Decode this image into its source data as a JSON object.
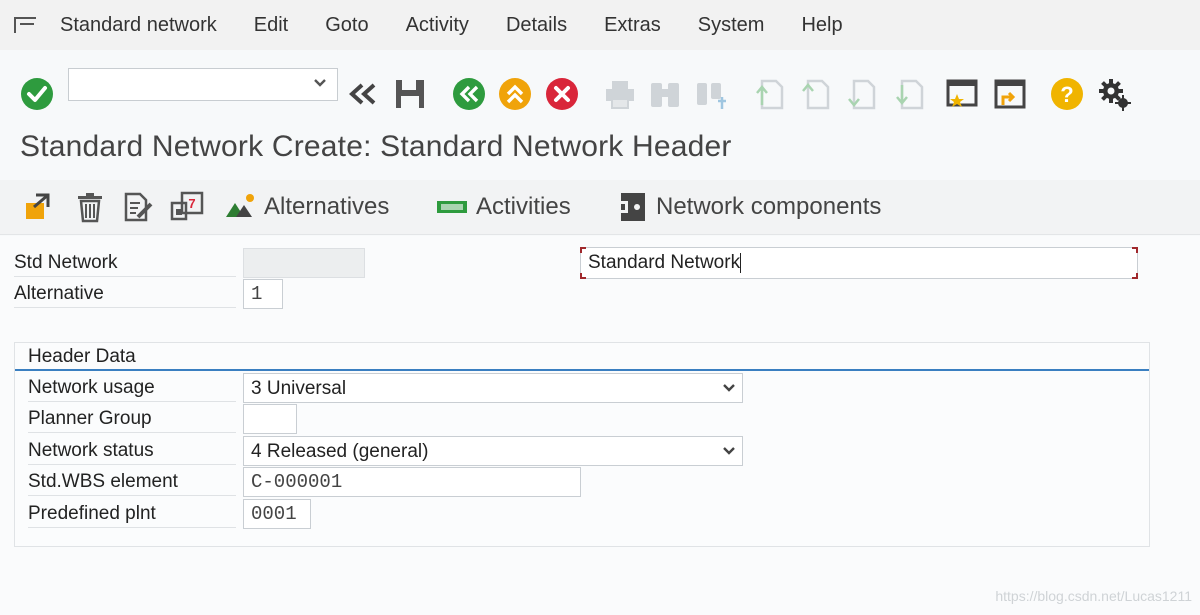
{
  "menubar": {
    "items": [
      "Standard network",
      "Edit",
      "Goto",
      "Activity",
      "Details",
      "Extras",
      "System",
      "Help"
    ]
  },
  "toolbar": {
    "command_value": "",
    "icons": [
      "enter-icon",
      "back-icon",
      "save-icon",
      "back-nav-icon",
      "exit-icon",
      "cancel-icon",
      "print-icon",
      "find-icon",
      "find-next-icon",
      "first-page-icon",
      "previous-page-icon",
      "next-page-icon",
      "last-page-icon",
      "create-session-icon",
      "generate-shortcut-icon",
      "help-icon",
      "customize-layout-icon"
    ]
  },
  "page": {
    "title": "Standard Network Create: Standard Network Header"
  },
  "app_toolbar": {
    "alternatives_label": "Alternatives",
    "activities_label": "Activities",
    "components_label": "Network components"
  },
  "form": {
    "std_network_label": "Std Network",
    "std_network_value": "",
    "description_value": "Standard Network",
    "alternative_label": "Alternative",
    "alternative_value": "1"
  },
  "header_data": {
    "title": "Header Data",
    "network_usage_label": "Network usage",
    "network_usage_value": "3 Universal",
    "planner_group_label": "Planner Group",
    "planner_group_value": "",
    "network_status_label": "Network status",
    "network_status_value": "4 Released (general)",
    "std_wbs_label": "Std.WBS element",
    "std_wbs_value": "C-000001",
    "predefined_plnt_label": "Predefined plnt",
    "predefined_plnt_value": "0001"
  },
  "watermark": "https://blog.csdn.net/Lucas1211",
  "colors": {
    "enter_green": "#2e9b3e",
    "nav_green": "#2e9b3e",
    "exit_orange": "#f0a30a",
    "cancel_red": "#d9263a",
    "help_yellow": "#f0b400",
    "focus_red": "#a0282c",
    "group_line_blue": "#3a7fc1"
  }
}
